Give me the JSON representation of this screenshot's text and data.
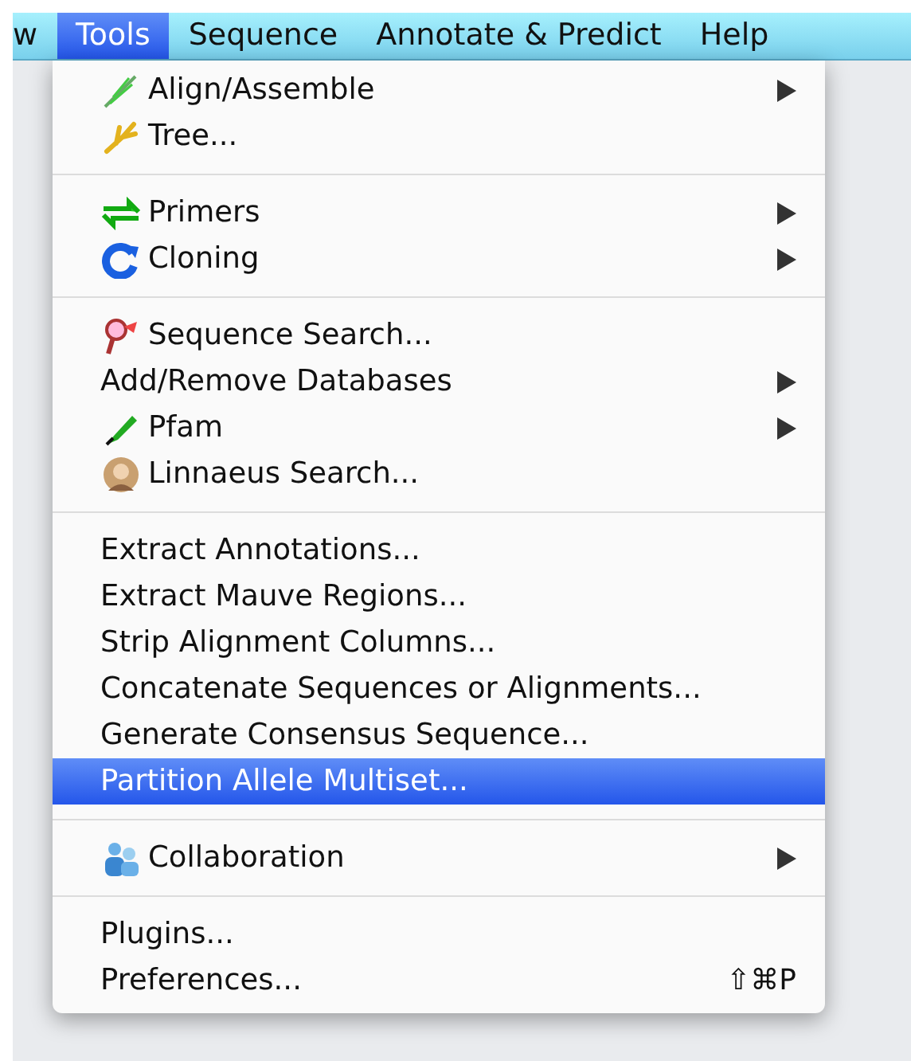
{
  "menu_bar": [
    {
      "label": "w",
      "selected": false
    },
    {
      "label": "Tools",
      "selected": true
    },
    {
      "label": "Sequence",
      "selected": false
    },
    {
      "label": "Annotate & Predict",
      "selected": false
    },
    {
      "label": "Help",
      "selected": false
    }
  ],
  "menu": {
    "groups": [
      {
        "items": [
          {
            "label": "Align/Assemble",
            "has_icon": true,
            "submenu": true,
            "selected": false
          },
          {
            "label": "Tree...",
            "has_icon": true,
            "submenu": false,
            "selected": false
          }
        ]
      },
      {
        "items": [
          {
            "label": "Primers",
            "has_icon": true,
            "submenu": true,
            "selected": false
          },
          {
            "label": "Cloning",
            "has_icon": true,
            "submenu": true,
            "selected": false
          }
        ]
      },
      {
        "items": [
          {
            "label": "Sequence Search...",
            "has_icon": true,
            "submenu": false,
            "selected": false
          },
          {
            "label": "Add/Remove Databases",
            "has_icon": false,
            "submenu": true,
            "selected": false
          },
          {
            "label": "Pfam",
            "has_icon": true,
            "submenu": true,
            "selected": false
          },
          {
            "label": "Linnaeus Search...",
            "has_icon": true,
            "submenu": false,
            "selected": false
          }
        ]
      },
      {
        "items": [
          {
            "label": "Extract Annotations...",
            "has_icon": false,
            "submenu": false,
            "selected": false
          },
          {
            "label": "Extract Mauve Regions...",
            "has_icon": false,
            "submenu": false,
            "selected": false
          },
          {
            "label": "Strip Alignment Columns...",
            "has_icon": false,
            "submenu": false,
            "selected": false
          },
          {
            "label": "Concatenate Sequences or Alignments...",
            "has_icon": false,
            "submenu": false,
            "selected": false
          },
          {
            "label": "Generate Consensus Sequence...",
            "has_icon": false,
            "submenu": false,
            "selected": false
          },
          {
            "label": "Partition Allele Multiset...",
            "has_icon": false,
            "submenu": false,
            "selected": true
          }
        ]
      },
      {
        "items": [
          {
            "label": "Collaboration",
            "has_icon": true,
            "submenu": true,
            "selected": false
          }
        ]
      },
      {
        "items": [
          {
            "label": "Plugins...",
            "has_icon": false,
            "submenu": false,
            "selected": false
          },
          {
            "label": "Preferences...",
            "has_icon": false,
            "submenu": false,
            "selected": false,
            "shortcut": "⇧⌘P"
          }
        ]
      }
    ]
  }
}
